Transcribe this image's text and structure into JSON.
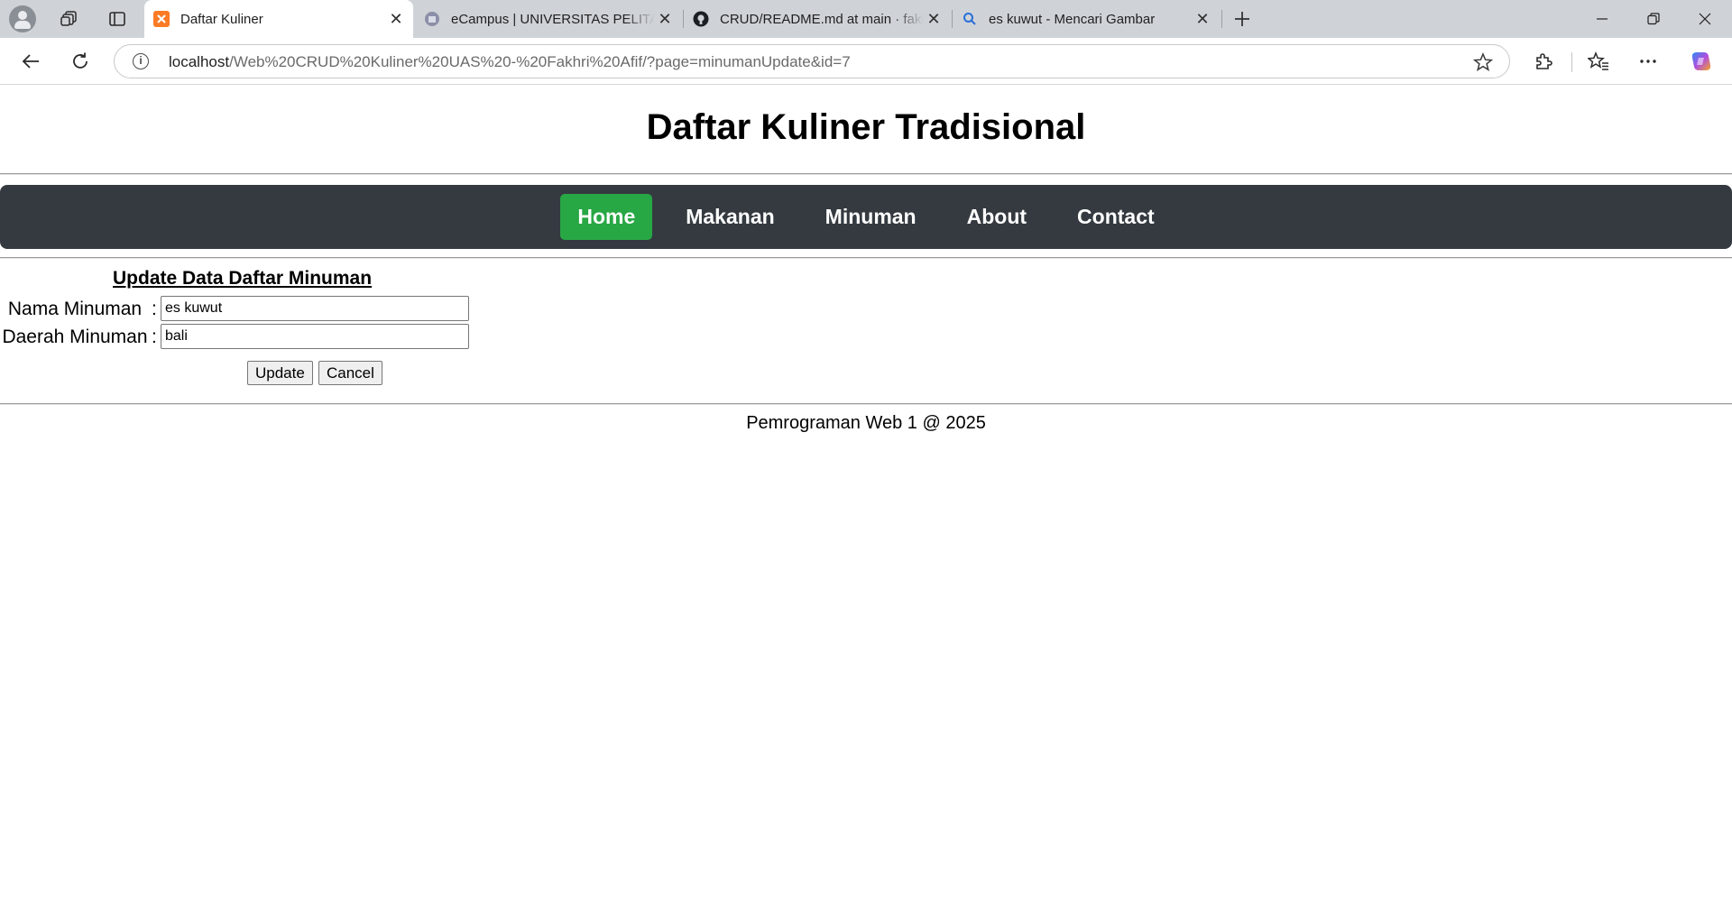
{
  "browser": {
    "tabs": [
      {
        "title": "Daftar Kuliner",
        "active": true,
        "favicon": "xampp-icon"
      },
      {
        "title": "eCampus | UNIVERSITAS PELITA BANGSA",
        "active": false,
        "favicon": "ecampus-icon"
      },
      {
        "title": "CRUD/README.md at main · fakhri",
        "active": false,
        "favicon": "github-icon"
      },
      {
        "title": "es kuwut - Mencari Gambar",
        "active": false,
        "favicon": "search-icon"
      }
    ],
    "url_host": "localhost",
    "url_path": "/Web%20CRUD%20Kuliner%20UAS%20-%20Fakhri%20Afif/?page=minumanUpdate&id=7"
  },
  "page": {
    "title": "Daftar Kuliner Tradisional",
    "nav": [
      {
        "label": "Home",
        "active": true
      },
      {
        "label": "Makanan",
        "active": false
      },
      {
        "label": "Minuman",
        "active": false
      },
      {
        "label": "About",
        "active": false
      },
      {
        "label": "Contact",
        "active": false
      }
    ],
    "form": {
      "heading": "Update Data Daftar Minuman",
      "fields": [
        {
          "label": "Nama Minuman",
          "colon": ":",
          "value": "es kuwut"
        },
        {
          "label": "Daerah Minuman",
          "colon": ":",
          "value": "bali"
        }
      ],
      "update_label": "Update",
      "cancel_label": "Cancel"
    },
    "footer": "Pemrograman Web 1 @ 2025"
  },
  "colors": {
    "navbar_bg": "#343a40",
    "nav_active_bg": "#28a745",
    "tabstrip_bg": "#cfd3d8"
  }
}
